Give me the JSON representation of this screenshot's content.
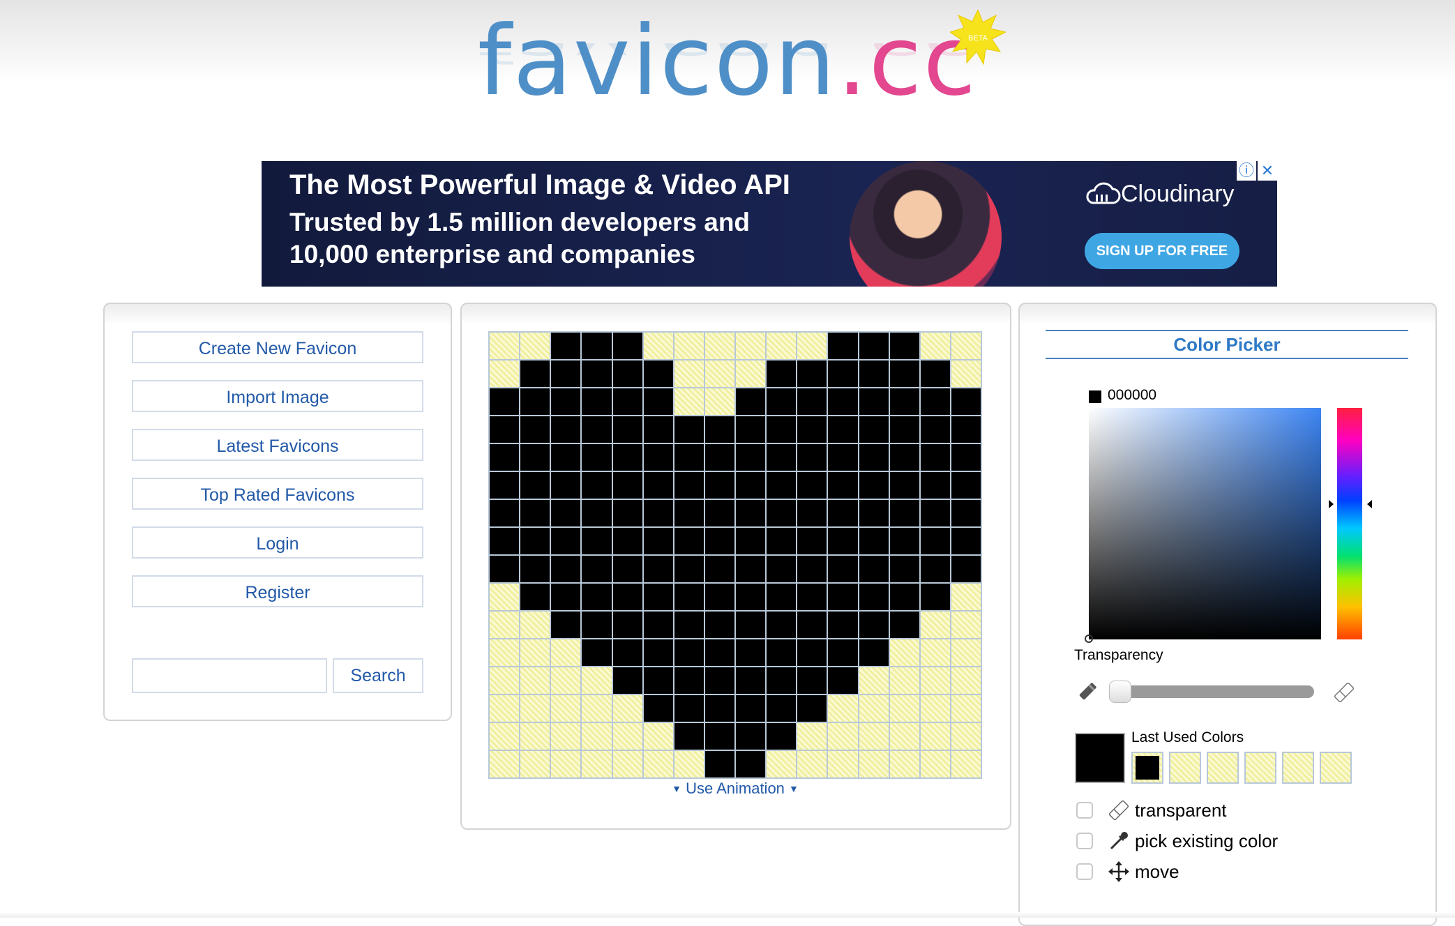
{
  "logo": {
    "part1": "favicon",
    "part2": ".cc",
    "badge": "BETA"
  },
  "ad": {
    "headline": "The Most Powerful Image & Video API",
    "line2": "Trusted by 1.5 million developers and",
    "line3": "10,000 enterprise and companies",
    "brand": "Cloudinary",
    "cta": "SIGN UP FOR FREE",
    "info_icon": "info-icon",
    "close_icon": "close-icon"
  },
  "sidebar": {
    "items": [
      {
        "label": "Create New Favicon"
      },
      {
        "label": "Import Image"
      },
      {
        "label": "Latest Favicons"
      },
      {
        "label": "Top Rated Favicons"
      },
      {
        "label": "Login"
      },
      {
        "label": "Register"
      }
    ],
    "search": {
      "value": "",
      "placeholder": "",
      "button": "Search"
    }
  },
  "editor": {
    "pixel_grid": [
      "0011100000011100",
      "0111110001111110",
      "1111110011111111",
      "1111111111111111",
      "1111111111111111",
      "1111111111111111",
      "1111111111111111",
      "1111111111111111",
      "1111111111111111",
      "0111111111111110",
      "0011111111111100",
      "0001111111111000",
      "0000111111110000",
      "0000011111100000",
      "0000001111000000",
      "0000000110000000"
    ],
    "use_animation": "Use Animation"
  },
  "color_picker": {
    "title": "Color Picker",
    "hex": "000000",
    "current_color": "#000000",
    "transparency_label": "Transparency",
    "transparency_value": 0,
    "last_used_label": "Last Used Colors",
    "last_used": [
      "#000000",
      "transparent",
      "transparent",
      "transparent",
      "transparent",
      "transparent"
    ],
    "options": [
      {
        "label": "transparent",
        "icon": "eraser-icon",
        "checked": false
      },
      {
        "label": "pick existing color",
        "icon": "eyedropper-icon",
        "checked": false
      },
      {
        "label": "move",
        "icon": "move-icon",
        "checked": false
      }
    ]
  }
}
